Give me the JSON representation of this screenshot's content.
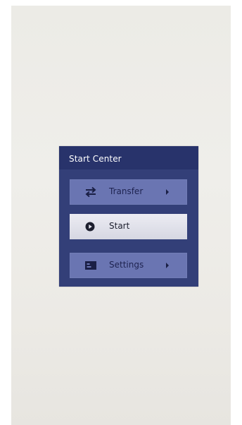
{
  "panel": {
    "title": "Start Center"
  },
  "menu": [
    {
      "label": "Transfer",
      "icon": "transfer-icon",
      "has_submenu": true,
      "active": false
    },
    {
      "label": "Start",
      "icon": "play-circle-icon",
      "has_submenu": false,
      "active": true
    },
    {
      "label": "Settings",
      "icon": "settings-icon",
      "has_submenu": true,
      "active": false
    }
  ],
  "colors": {
    "panel_header": "#28336b",
    "panel_body": "#333f78",
    "button": "#6a75b2",
    "button_active": "#e4e5ee",
    "icon_dark": "#1a1f45"
  }
}
